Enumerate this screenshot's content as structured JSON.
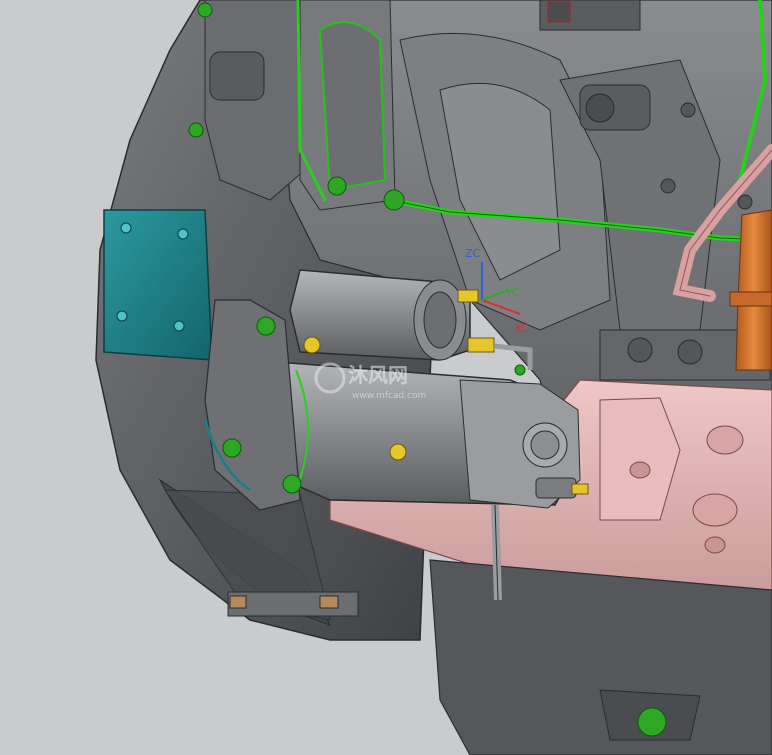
{
  "viewport": {
    "background": "#c9cbcd",
    "axes": {
      "z_label": "ZC",
      "x_label": "XC",
      "y_label": "YC"
    },
    "watermark": {
      "main": "沐风网",
      "sub": "www.mfcad.com"
    }
  },
  "colors": {
    "housing": "#5e6064",
    "housing_dark": "#3c3e42",
    "starter": "#8e9094",
    "teal_plate": "#1d7f86",
    "pink_block": "#e4b4b4",
    "green_line": "#27d11b",
    "orange_filter": "#d9742b",
    "brass": "#e6c62a"
  }
}
